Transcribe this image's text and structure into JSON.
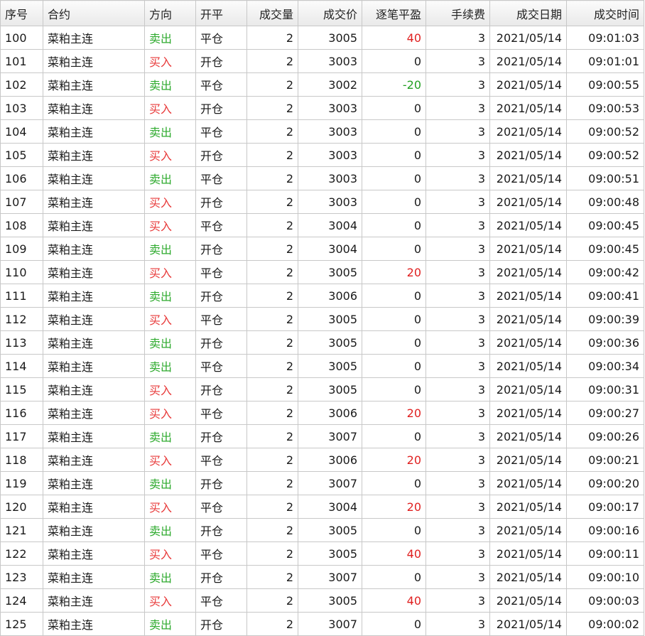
{
  "table": {
    "columns": [
      "序号",
      "合约",
      "方向",
      "开平",
      "成交量",
      "成交价",
      "逐笔平盈",
      "手续费",
      "成交日期",
      "成交时间"
    ],
    "rows": [
      [
        "100",
        "菜粕主连",
        "卖出",
        "平仓",
        "2",
        "3005",
        "40",
        "3",
        "2021/05/14",
        "09:01:03"
      ],
      [
        "101",
        "菜粕主连",
        "买入",
        "开仓",
        "2",
        "3003",
        "0",
        "3",
        "2021/05/14",
        "09:01:01"
      ],
      [
        "102",
        "菜粕主连",
        "卖出",
        "平仓",
        "2",
        "3002",
        "-20",
        "3",
        "2021/05/14",
        "09:00:55"
      ],
      [
        "103",
        "菜粕主连",
        "买入",
        "开仓",
        "2",
        "3003",
        "0",
        "3",
        "2021/05/14",
        "09:00:53"
      ],
      [
        "104",
        "菜粕主连",
        "卖出",
        "平仓",
        "2",
        "3003",
        "0",
        "3",
        "2021/05/14",
        "09:00:52"
      ],
      [
        "105",
        "菜粕主连",
        "买入",
        "开仓",
        "2",
        "3003",
        "0",
        "3",
        "2021/05/14",
        "09:00:52"
      ],
      [
        "106",
        "菜粕主连",
        "卖出",
        "平仓",
        "2",
        "3003",
        "0",
        "3",
        "2021/05/14",
        "09:00:51"
      ],
      [
        "107",
        "菜粕主连",
        "买入",
        "开仓",
        "2",
        "3003",
        "0",
        "3",
        "2021/05/14",
        "09:00:48"
      ],
      [
        "108",
        "菜粕主连",
        "买入",
        "平仓",
        "2",
        "3004",
        "0",
        "3",
        "2021/05/14",
        "09:00:45"
      ],
      [
        "109",
        "菜粕主连",
        "卖出",
        "开仓",
        "2",
        "3004",
        "0",
        "3",
        "2021/05/14",
        "09:00:45"
      ],
      [
        "110",
        "菜粕主连",
        "买入",
        "平仓",
        "2",
        "3005",
        "20",
        "3",
        "2021/05/14",
        "09:00:42"
      ],
      [
        "111",
        "菜粕主连",
        "卖出",
        "开仓",
        "2",
        "3006",
        "0",
        "3",
        "2021/05/14",
        "09:00:41"
      ],
      [
        "112",
        "菜粕主连",
        "买入",
        "平仓",
        "2",
        "3005",
        "0",
        "3",
        "2021/05/14",
        "09:00:39"
      ],
      [
        "113",
        "菜粕主连",
        "卖出",
        "开仓",
        "2",
        "3005",
        "0",
        "3",
        "2021/05/14",
        "09:00:36"
      ],
      [
        "114",
        "菜粕主连",
        "卖出",
        "平仓",
        "2",
        "3005",
        "0",
        "3",
        "2021/05/14",
        "09:00:34"
      ],
      [
        "115",
        "菜粕主连",
        "买入",
        "开仓",
        "2",
        "3005",
        "0",
        "3",
        "2021/05/14",
        "09:00:31"
      ],
      [
        "116",
        "菜粕主连",
        "买入",
        "平仓",
        "2",
        "3006",
        "20",
        "3",
        "2021/05/14",
        "09:00:27"
      ],
      [
        "117",
        "菜粕主连",
        "卖出",
        "开仓",
        "2",
        "3007",
        "0",
        "3",
        "2021/05/14",
        "09:00:26"
      ],
      [
        "118",
        "菜粕主连",
        "买入",
        "平仓",
        "2",
        "3006",
        "20",
        "3",
        "2021/05/14",
        "09:00:21"
      ],
      [
        "119",
        "菜粕主连",
        "卖出",
        "开仓",
        "2",
        "3007",
        "0",
        "3",
        "2021/05/14",
        "09:00:20"
      ],
      [
        "120",
        "菜粕主连",
        "买入",
        "平仓",
        "2",
        "3004",
        "20",
        "3",
        "2021/05/14",
        "09:00:17"
      ],
      [
        "121",
        "菜粕主连",
        "卖出",
        "开仓",
        "2",
        "3005",
        "0",
        "3",
        "2021/05/14",
        "09:00:16"
      ],
      [
        "122",
        "菜粕主连",
        "买入",
        "平仓",
        "2",
        "3005",
        "40",
        "3",
        "2021/05/14",
        "09:00:11"
      ],
      [
        "123",
        "菜粕主连",
        "卖出",
        "开仓",
        "2",
        "3007",
        "0",
        "3",
        "2021/05/14",
        "09:00:10"
      ],
      [
        "124",
        "菜粕主连",
        "买入",
        "平仓",
        "2",
        "3005",
        "40",
        "3",
        "2021/05/14",
        "09:00:03"
      ],
      [
        "125",
        "菜粕主连",
        "卖出",
        "开仓",
        "2",
        "3007",
        "0",
        "3",
        "2021/05/14",
        "09:00:02"
      ]
    ]
  },
  "colors": {
    "buy": "#e83a3a",
    "sell": "#2eaa2e",
    "profit": "#e02020",
    "loss": "#22a022"
  }
}
